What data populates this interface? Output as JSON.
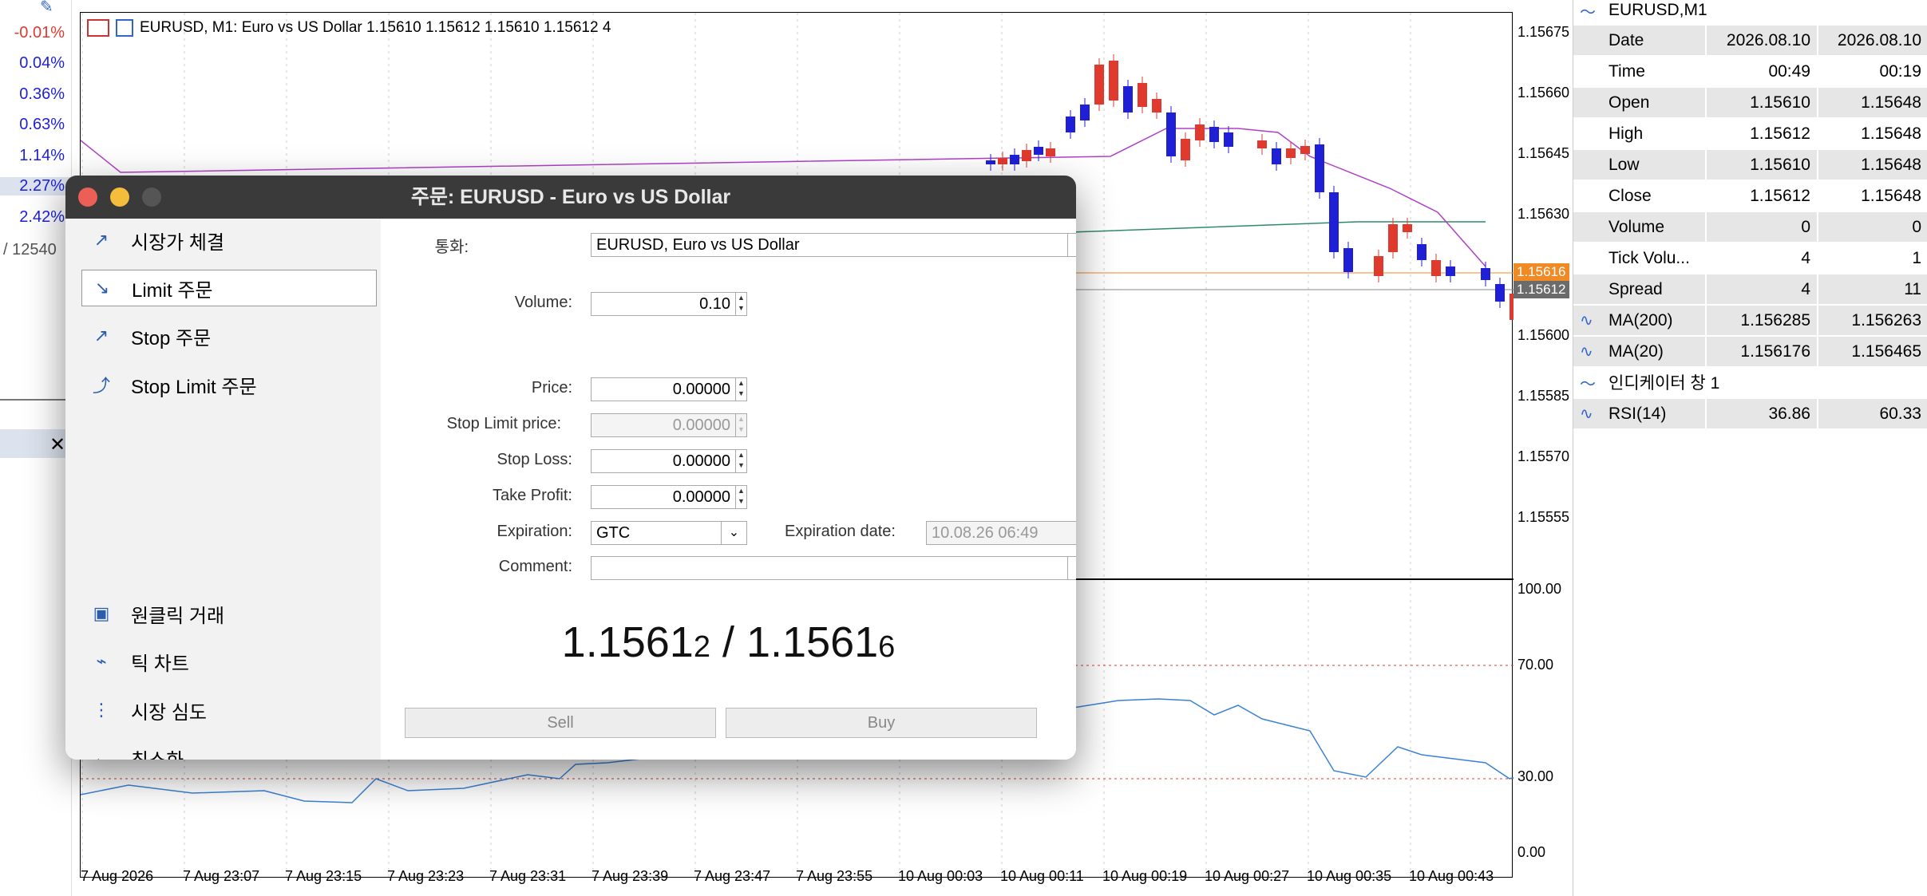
{
  "market_watch": {
    "changes": [
      "-0.01%",
      "0.04%",
      "0.36%",
      "0.63%",
      "1.14%",
      "2.27%",
      "2.42%"
    ],
    "partial_text": "/ 12540"
  },
  "chart": {
    "symbol_header": "EURUSD, M1:  Euro vs US Dollar  1.15610 1.15612 1.15610 1.15612  4",
    "price_axis": [
      "1.15675",
      "1.15660",
      "1.15645",
      "1.15630",
      "1.15615",
      "1.15600",
      "1.15585",
      "1.15570",
      "1.15555"
    ],
    "bid_tag": "1.15616",
    "ask_tag": "1.15612",
    "rsi_axis": [
      "100.00",
      "70.00",
      "30.00",
      "0.00"
    ],
    "time_axis": [
      "7 Aug 2026",
      "7 Aug 23:07",
      "7 Aug 23:15",
      "7 Aug 23:23",
      "7 Aug 23:31",
      "7 Aug 23:39",
      "7 Aug 23:47",
      "7 Aug 23:55",
      "10 Aug 00:03",
      "10 Aug 00:11",
      "10 Aug 00:19",
      "10 Aug 00:27",
      "10 Aug 00:35",
      "10 Aug 00:43"
    ],
    "colors": {
      "bull": "#1f1fd6",
      "bear": "#e03a2f",
      "ma200": "#2e8b6a",
      "ma20": "#b040c8",
      "rsi": "#3b82d6"
    }
  },
  "data_window": {
    "title": "EURUSD,M1",
    "rows": [
      {
        "label": "Date",
        "v1": "2026.08.10",
        "v2": "2026.08.10"
      },
      {
        "label": "Time",
        "v1": "00:49",
        "v2": "00:19"
      },
      {
        "label": "Open",
        "v1": "1.15610",
        "v2": "1.15648"
      },
      {
        "label": "High",
        "v1": "1.15612",
        "v2": "1.15648"
      },
      {
        "label": "Low",
        "v1": "1.15610",
        "v2": "1.15648"
      },
      {
        "label": "Close",
        "v1": "1.15612",
        "v2": "1.15648"
      },
      {
        "label": "Volume",
        "v1": "0",
        "v2": "0"
      },
      {
        "label": "Tick Volu...",
        "v1": "4",
        "v2": "1"
      },
      {
        "label": "Spread",
        "v1": "4",
        "v2": "11"
      },
      {
        "label": "MA(200)",
        "v1": "1.156285",
        "v2": "1.156263"
      },
      {
        "label": "MA(20)",
        "v1": "1.156176",
        "v2": "1.156465"
      }
    ],
    "indicator_window": "인디케이터 창 1",
    "rsi_row": {
      "label": "RSI(14)",
      "v1": "36.86",
      "v2": "60.33"
    }
  },
  "dialog": {
    "title": "주문: EURUSD - Euro vs US Dollar",
    "side_top": [
      {
        "label": "시장가 체결",
        "icon": "market-icon"
      },
      {
        "label": "Limit 주문",
        "icon": "limit-icon"
      },
      {
        "label": "Stop 주문",
        "icon": "stop-icon"
      },
      {
        "label": "Stop Limit 주문",
        "icon": "stop-limit-icon"
      }
    ],
    "side_bottom": [
      {
        "label": "원클릭 거래",
        "icon": "one-click-icon"
      },
      {
        "label": "틱 차트",
        "icon": "tick-chart-icon"
      },
      {
        "label": "시장 심도",
        "icon": "depth-icon"
      },
      {
        "label": "최소화",
        "icon": "arrow-left-icon"
      }
    ],
    "form": {
      "symbol_label": "통화:",
      "symbol_value": "EURUSD, Euro vs US Dollar",
      "volume_label": "Volume:",
      "volume_value": "0.10",
      "price_label": "Price:",
      "price_value": "0.00000",
      "stop_limit_label": "Stop Limit price:",
      "stop_limit_value": "0.00000",
      "sl_label": "Stop Loss:",
      "sl_value": "0.00000",
      "tp_label": "Take Profit:",
      "tp_value": "0.00000",
      "expiration_label": "Expiration:",
      "expiration_value": "GTC",
      "exp_date_label": "Expiration date:",
      "exp_date_value": "10.08.26 06:49",
      "comment_label": "Comment:",
      "comment_value": ""
    },
    "quote": {
      "bid_main": "1.1561",
      "bid_small": "2",
      "sep": " / ",
      "ask_main": "1.1561",
      "ask_small": "6"
    },
    "sell_label": "Sell",
    "buy_label": "Buy"
  }
}
